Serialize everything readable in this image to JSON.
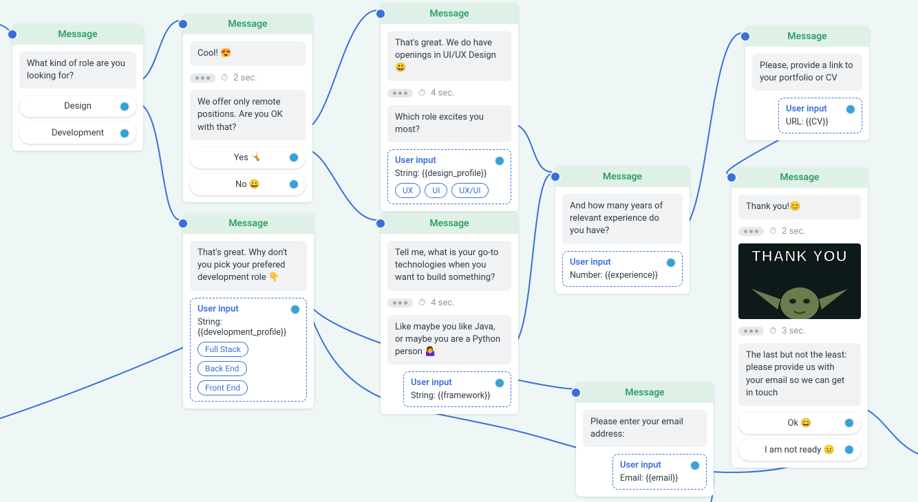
{
  "labels": {
    "message": "Message",
    "user_input": "User input"
  },
  "node1": {
    "text": "What kind of role are you looking for?",
    "opt1": "Design",
    "opt2": "Development"
  },
  "node2": {
    "text1": "Cool! 😍",
    "delay": "2 sec.",
    "text2": "We offer only remote positions. Are you OK with that?",
    "opt1": "Yes 🤸",
    "opt2": "No 😀"
  },
  "node3": {
    "text1": "That's great. We do have openings in UI/UX Design 😃",
    "delay": "4 sec.",
    "text2": "Which role excites you most?",
    "input_label": "String: {{design_profile}}",
    "chip1": "UX",
    "chip2": "UI",
    "chip3": "UX/UI"
  },
  "node4": {
    "text": "Please, provide a link to your portfolio or CV",
    "input_label": "URL: {{CV}}"
  },
  "node5": {
    "text": "That's great. Why don't you pick your prefered development role 👇",
    "input_label": "String: {{development_profile}}",
    "chip1": "Full Stack",
    "chip2": "Back End",
    "chip3": "Front End"
  },
  "node6": {
    "text1": "Tell me, what is your go-to technologies when you want to build something?",
    "delay": "4 sec.",
    "text2": "Like maybe you like Java, or maybe you are a Python person 🤷‍♀️",
    "input_label": "String: {{framework}}"
  },
  "node7": {
    "text": "And how many years of relevant experience do you have?",
    "input_label": "Number: {{experience}}"
  },
  "node8": {
    "text": "Please enter your email address:",
    "input_label": "Email: {{email}}"
  },
  "node9": {
    "text1": "Thank you!😊",
    "delay1": "2 sec.",
    "meme": "THANK YOU",
    "delay2": "3 sec.",
    "text2": "The last but not the least: please provide us with your email so we can get in touch",
    "opt1": "Ok 😄",
    "opt2": "I am not ready 😐"
  }
}
